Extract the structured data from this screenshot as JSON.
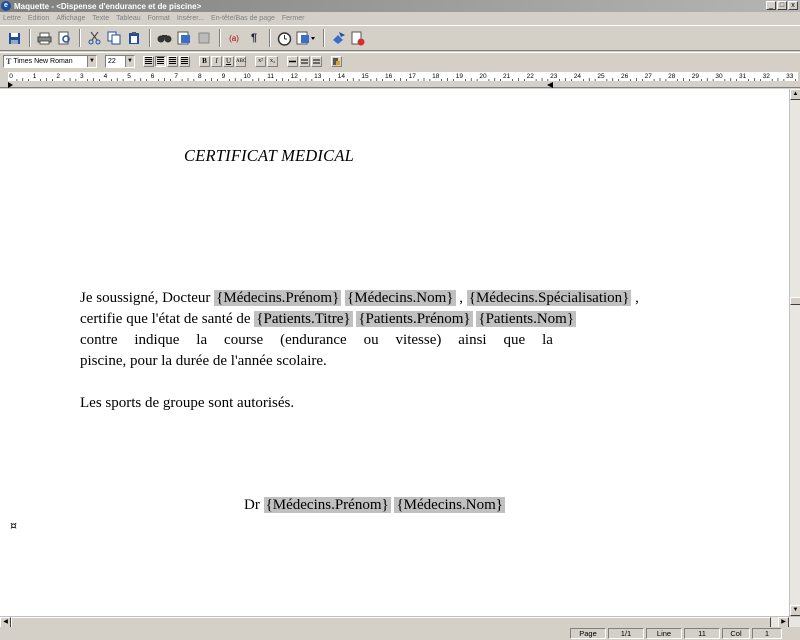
{
  "window": {
    "title": "Maquette -  <Dispense d'endurance et de piscine>",
    "buttons": [
      "_",
      "□",
      "x"
    ]
  },
  "menu": [
    "Lettre",
    "Edition",
    "Affichage",
    "Texte",
    "Tableau",
    "Format",
    "Insérer...",
    "En-tête/Bas de page",
    "Fermer"
  ],
  "toolbar": {
    "icons": [
      "save-icon",
      "print-icon",
      "print-preview-icon",
      "cut-icon",
      "copy-icon",
      "paste-icon",
      "find-icon",
      "insert-image-icon",
      "insert-object-icon",
      "field-icon",
      "pilcrow-icon",
      "date-time-icon",
      "styles-icon",
      "export-icon",
      "close-document-icon"
    ],
    "field_label": "(a)",
    "pilcrow_label": "¶"
  },
  "format": {
    "font": "Times New Roman",
    "size": "22",
    "bold": "B",
    "italic": "I",
    "underline": "U",
    "abc": "ABC",
    "superscript": "x²",
    "subscript": "x₂"
  },
  "ruler": {
    "labels": [
      "0",
      "1",
      "2",
      "3",
      "4",
      "5",
      "6",
      "7",
      "8",
      "9",
      "10",
      "11",
      "12",
      "13",
      "14",
      "15",
      "16",
      "17",
      "18",
      "19",
      "20",
      "21",
      "22",
      "23",
      "24",
      "25",
      "26",
      "27",
      "28",
      "29",
      "30",
      "31",
      "32",
      "33"
    ]
  },
  "document": {
    "title": "CERTIFICAT MEDICAL",
    "line1": {
      "t1": "Je soussigné, Docteur ",
      "f1": "{Médecins.Prénom}",
      "t2": " ",
      "f2": "{Médecins.Nom}",
      "t3": " , ",
      "f3": "{Médecins.Spécialisation}",
      "t4": " ,"
    },
    "line2": {
      "t1": "certifie que l'état de santé de ",
      "f1": "{Patients.Titre}",
      "f2": "{Patients.Prénom}",
      "f3": "{Patients.Nom}"
    },
    "line3_words": [
      "contre",
      "indique",
      "la",
      "course",
      "(endurance",
      "ou",
      "vitesse)",
      "ainsi",
      "que",
      "la"
    ],
    "line4": "piscine, pour la durée de l'année scolaire.",
    "line5": "Les sports de groupe sont autorisés.",
    "signature": {
      "t1": "Dr ",
      "f1": "{Médecins.Prénom}",
      "f2": "{Médecins.Nom}"
    },
    "end_mark": "¤"
  },
  "status": {
    "page_label": "Page",
    "page_value": "1/1",
    "line_label": "Line",
    "line_value": "11",
    "col_label": "Col",
    "col_value": "1"
  }
}
